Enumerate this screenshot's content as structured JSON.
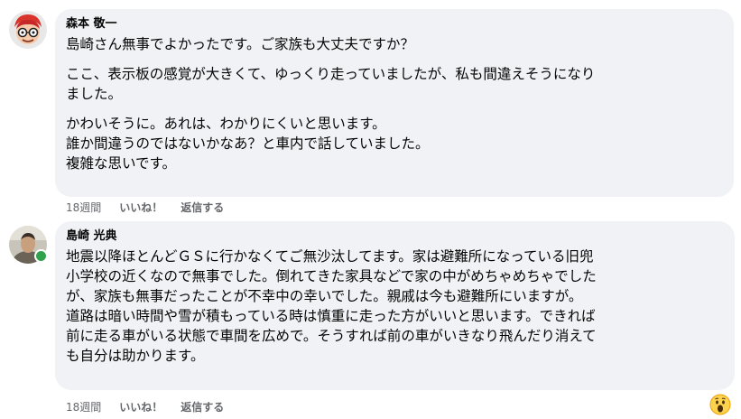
{
  "comments": [
    {
      "author": "森本 敬一",
      "paragraphs": [
        [
          "島崎さん無事でよかったです。ご家族も大丈夫ですか？"
        ],
        [
          "ここ、表示板の感覚が大きくて、ゆっくり走っていましたが、私も間違えそうになり",
          "ました。"
        ],
        [
          "かわいそうに。あれは、わかりにくいと思います。",
          "誰か間違うのではないかなあ？と車内で話していました。",
          "複雑な思いです。"
        ]
      ],
      "time": "18週間",
      "like_label": "いいね！",
      "reply_label": "返信する"
    },
    {
      "author": "島崎 光典",
      "paragraphs": [
        [
          "地震以降ほとんどＧＳに行かなくてご無沙汰してます。家は避難所になっている旧兜",
          "小学校の近くなので無事でした。倒れてきた家具などで家の中がめちゃめちゃでした",
          "が、家族も無事だったことが不幸中の幸いでした。親戚は今も避難所にいますが。",
          "道路は暗い時間や雪が積もっている時は慎重に走った方がいいと思います。できれば",
          "前に走る車がいる状態で車間を広めで。そうすれば前の車がいきなり飛んだり消えて",
          "も自分は助かります。"
        ]
      ],
      "time": "18週間",
      "like_label": "いいね！",
      "reply_label": "返信する",
      "reaction": "wow-emoji-icon",
      "online": true
    }
  ],
  "colors": {
    "bubble": "#f0f2f5",
    "secondary_text": "#65676b",
    "online": "#31a24c"
  }
}
